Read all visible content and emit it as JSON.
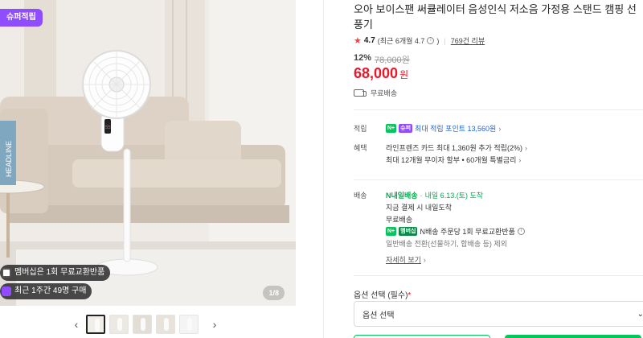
{
  "gallery": {
    "badge": "슈퍼적립",
    "chip_exchange": "멤버십은 1회 무료교환반품",
    "chip_purchases": "최근 1주간 49명 구매",
    "counter": "1/8",
    "thumb_prev": "‹",
    "thumb_next": "›",
    "fan_display": "55",
    "book_text": "HEADLINE"
  },
  "product": {
    "title": "오아 보이스팬 써큘레이터 음성인식 저소음 가정용 스탠드 캠핑 선풍기",
    "rating": "4.7",
    "rating_note": "(최근 6개월 4.7",
    "rating_note_close": ")",
    "review_count": "769건 리뷰",
    "discount_pct": "12%",
    "original_price": "78,000원",
    "price": "68,000",
    "price_unit": "원",
    "shipping_short": "무료배송"
  },
  "benefits": {
    "points_label": "적립",
    "points_tag_n": "N+",
    "points_tag_super": "슈퍼",
    "points_text": "최대 적립 포인트 13,560원",
    "benefit_label": "혜택",
    "card_text": "라인프렌즈 카드 최대 1,360원 추가 적립(2%)",
    "installment_text": "최대 12개월 무이자 할부 • 60개월 특별금리"
  },
  "delivery": {
    "label": "배송",
    "tag_text": "N내일배송",
    "arrival": "내일 6.13.(토) 도착",
    "sub1": "지금 결제 시 내일도착",
    "sub2": "무료배송",
    "tag_membership": "멤버십",
    "return_text": "N배송 주문당 1회 무료교환반품",
    "exclude_text": "일반배송 전환(선물하기, 합배송 등) 제외",
    "detail_link": "자세히 보기"
  },
  "options": {
    "label": "옵션 선택 (필수)",
    "required_mark": "*",
    "select_value": "옵션 선택"
  },
  "colors": {
    "accent_red": "#e8192c",
    "naver_green": "#03c75a",
    "super_purple": "#8f4dff"
  }
}
